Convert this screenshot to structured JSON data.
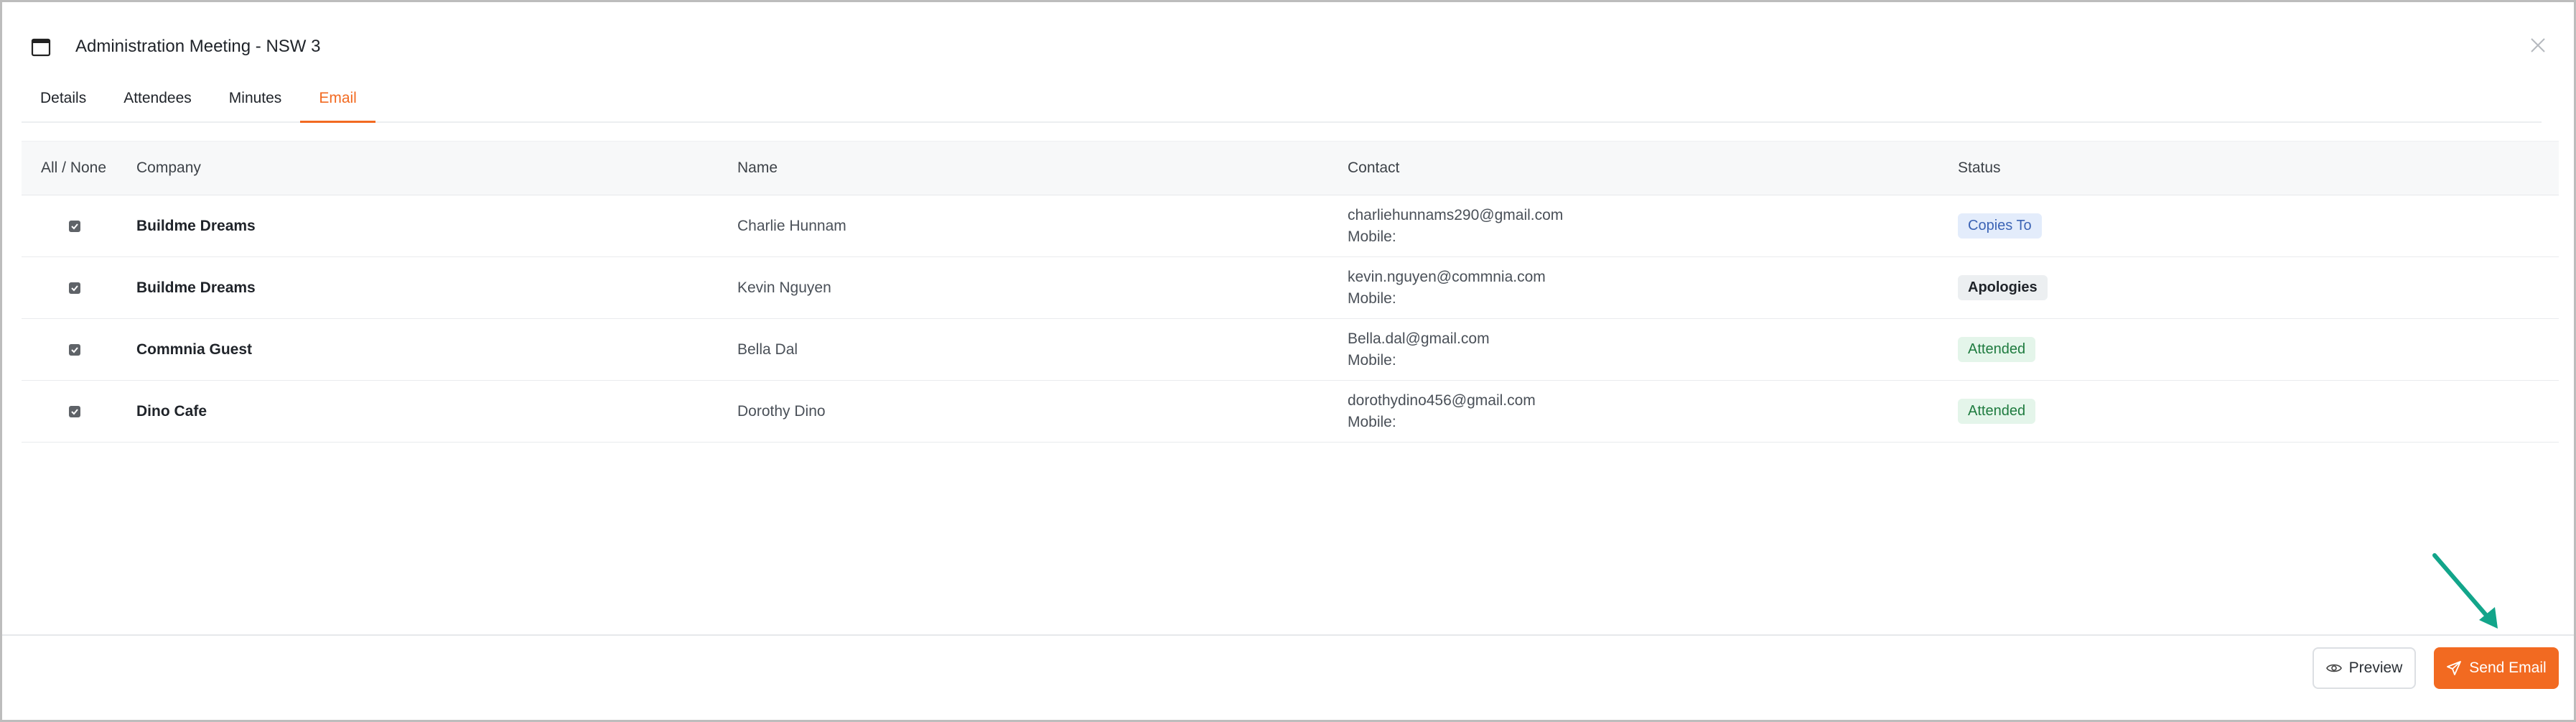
{
  "modal": {
    "title": "Administration Meeting - NSW 3",
    "icon": "calendar-icon",
    "close_icon": "close-icon"
  },
  "tabs": [
    {
      "label": "Details",
      "active": false
    },
    {
      "label": "Attendees",
      "active": false
    },
    {
      "label": "Minutes",
      "active": false
    },
    {
      "label": "Email",
      "active": true
    }
  ],
  "table": {
    "headers": {
      "select": "All / None",
      "company": "Company",
      "name": "Name",
      "contact": "Contact",
      "status": "Status"
    },
    "rows": [
      {
        "checked": true,
        "company": "Buildme Dreams",
        "name": "Charlie Hunnam",
        "email": "charliehunnams290@gmail.com",
        "mobile": "Mobile:",
        "status": "Copies To"
      },
      {
        "checked": true,
        "company": "Buildme Dreams",
        "name": "Kevin Nguyen",
        "email": "kevin.nguyen@commnia.com",
        "mobile": "Mobile:",
        "status": "Apologies"
      },
      {
        "checked": true,
        "company": "Commnia Guest",
        "name": "Bella Dal",
        "email": "Bella.dal@gmail.com",
        "mobile": "Mobile:",
        "status": "Attended"
      },
      {
        "checked": true,
        "company": "Dino Cafe",
        "name": "Dorothy Dino",
        "email": "dorothydino456@gmail.com",
        "mobile": "Mobile:",
        "status": "Attended"
      }
    ]
  },
  "footer": {
    "preview_label": "Preview",
    "preview_icon": "eye-icon",
    "send_label": "Send Email",
    "send_icon": "send-icon"
  },
  "colors": {
    "accent": "#f26a21",
    "annotation_arrow": "#12a58a"
  }
}
